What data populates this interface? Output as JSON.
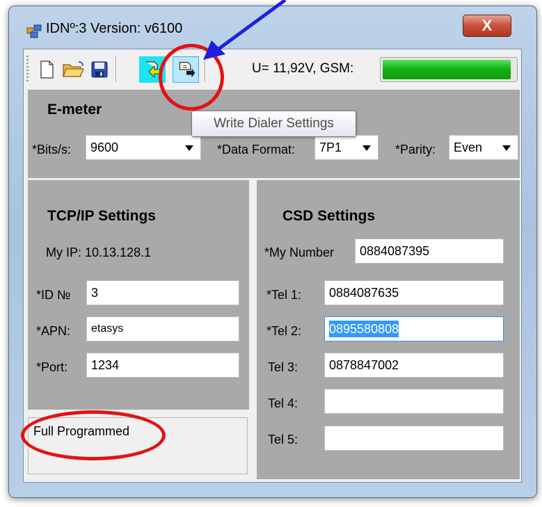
{
  "window": {
    "title": "IDNº:3 Version: v6100",
    "close_glyph": "X"
  },
  "toolbar": {
    "buttons": [
      "new-file-icon",
      "open-folder-icon",
      "save-icon",
      "read-dialer-settings-icon",
      "write-dialer-settings-icon"
    ],
    "status_text": "U= 11,92V, GSM:",
    "gsm_level": 0.97,
    "tooltip": "Write Dialer Settings"
  },
  "emeter": {
    "header": "E-meter",
    "bits_label": "*Bits/s:",
    "bits_value": "9600",
    "format_label": "*Data Format:",
    "format_value": "7P1",
    "parity_label": "*Parity:",
    "parity_value": "Even"
  },
  "tcpip": {
    "header": "TCP/IP Settings",
    "my_ip": "My IP: 10.13.128.1",
    "id_label": "*ID №",
    "id_value": "3",
    "apn_label": "*APN:",
    "apn_value": "etasys",
    "port_label": "*Port:",
    "port_value": "1234"
  },
  "status": {
    "text": "Full Programmed"
  },
  "csd": {
    "header": "CSD Settings",
    "my_number_label": "*My Number",
    "my_number_value": "0884087395",
    "phones": [
      {
        "label": "*Tel 1:",
        "value": "0884087635"
      },
      {
        "label": "*Tel 2:",
        "value": "0895580808"
      },
      {
        "label": "Tel 3:",
        "value": "0878847002"
      },
      {
        "label": "Tel 4:",
        "value": ""
      },
      {
        "label": "Tel 5:",
        "value": ""
      }
    ]
  },
  "colors": {
    "annotation_ring": "#e31212",
    "annotation_arrow": "#1f1fe0",
    "gsm_bar": "#12b312",
    "selection": "#3399ff"
  }
}
